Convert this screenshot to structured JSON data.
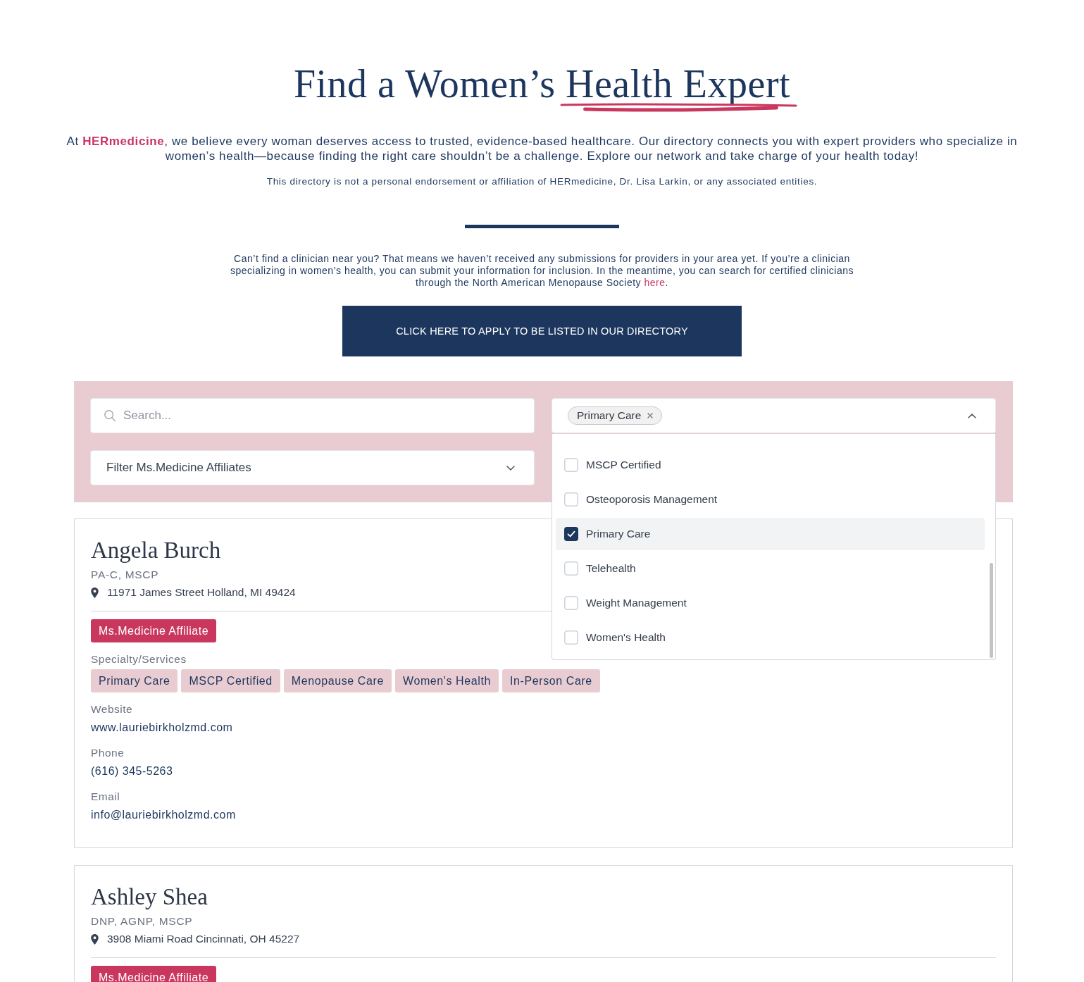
{
  "header": {
    "title": "Find a Women’s",
    "title_highlight": "Health Expert",
    "intro": "At **HERmedicine**, we believe every woman deserves access to trusted, evidence-based healthcare. Our directory connects you with expert providers who specialize in women’s health—because finding the right care shouldn’t be a challenge. Explore our network and take charge of your health today!",
    "disclaimer": "This directory is not a personal endorsement or affiliation of HERmedicine, Dr. Lisa Larkin, or any associated entities."
  },
  "notice": {
    "text": "Can’t find a clinician near you? That means we haven’t received any submissions for providers in your area yet. If you’re a clinician specializing in women’s health, you can submit your information for inclusion. In the meantime, you can search for certified clinicians through the North American Menopause Society ",
    "link": "here",
    "end": "."
  },
  "apply_button": {
    "label": "CLICK HERE TO APPLY TO BE LISTED IN OUR DIRECTORY"
  },
  "filters": {
    "search": {
      "placeholder": "Search..."
    },
    "specialty_filter": {
      "expanded": true,
      "chips": [
        {
          "label": "Primary Care"
        }
      ],
      "options": [
        {
          "label": "MSCP Certified",
          "checked": false
        },
        {
          "label": "Osteoporosis Management",
          "checked": false
        },
        {
          "label": "Primary Care",
          "checked": true
        },
        {
          "label": "Telehealth",
          "checked": false
        },
        {
          "label": "Weight Management",
          "checked": false
        },
        {
          "label": "Women's Health",
          "checked": false
        }
      ]
    },
    "affiliate_filter": {
      "placeholder": "Filter Ms.Medicine Affiliates",
      "expanded": false
    }
  },
  "providers": [
    {
      "name": "Angela Burch",
      "credentials": "PA-C, MSCP",
      "address": "11971 James Street Holland, MI 49424",
      "badge": "Ms.Medicine Affiliate",
      "specialty_heading": "Specialty/Services",
      "specialties": [
        "Primary Care",
        "MSCP Certified",
        "Menopause Care",
        "Women's Health",
        "In-Person Care"
      ],
      "contacts": [
        {
          "label": "Website",
          "value": "www.lauriebirkholzmd.com"
        },
        {
          "label": "Phone",
          "value": "(616) 345-5263"
        },
        {
          "label": "Email",
          "value": "info@lauriebirkholzmd.com"
        }
      ]
    },
    {
      "name": "Ashley Shea",
      "credentials": "DNP, AGNP, MSCP",
      "address": "3908 Miami Road Cincinnati, OH 45227",
      "badge": "Ms.Medicine Affiliate"
    }
  ]
}
